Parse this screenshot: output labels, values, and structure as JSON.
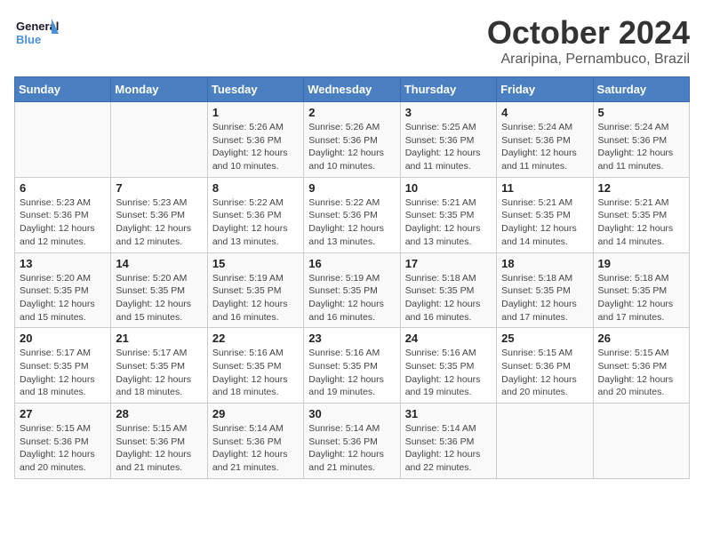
{
  "logo": {
    "line1": "General",
    "line2": "Blue"
  },
  "title": "October 2024",
  "location": "Araripina, Pernambuco, Brazil",
  "days_of_week": [
    "Sunday",
    "Monday",
    "Tuesday",
    "Wednesday",
    "Thursday",
    "Friday",
    "Saturday"
  ],
  "weeks": [
    [
      {
        "day": "",
        "info": ""
      },
      {
        "day": "",
        "info": ""
      },
      {
        "day": "1",
        "info": "Sunrise: 5:26 AM\nSunset: 5:36 PM\nDaylight: 12 hours\nand 10 minutes."
      },
      {
        "day": "2",
        "info": "Sunrise: 5:26 AM\nSunset: 5:36 PM\nDaylight: 12 hours\nand 10 minutes."
      },
      {
        "day": "3",
        "info": "Sunrise: 5:25 AM\nSunset: 5:36 PM\nDaylight: 12 hours\nand 11 minutes."
      },
      {
        "day": "4",
        "info": "Sunrise: 5:24 AM\nSunset: 5:36 PM\nDaylight: 12 hours\nand 11 minutes."
      },
      {
        "day": "5",
        "info": "Sunrise: 5:24 AM\nSunset: 5:36 PM\nDaylight: 12 hours\nand 11 minutes."
      }
    ],
    [
      {
        "day": "6",
        "info": "Sunrise: 5:23 AM\nSunset: 5:36 PM\nDaylight: 12 hours\nand 12 minutes."
      },
      {
        "day": "7",
        "info": "Sunrise: 5:23 AM\nSunset: 5:36 PM\nDaylight: 12 hours\nand 12 minutes."
      },
      {
        "day": "8",
        "info": "Sunrise: 5:22 AM\nSunset: 5:36 PM\nDaylight: 12 hours\nand 13 minutes."
      },
      {
        "day": "9",
        "info": "Sunrise: 5:22 AM\nSunset: 5:36 PM\nDaylight: 12 hours\nand 13 minutes."
      },
      {
        "day": "10",
        "info": "Sunrise: 5:21 AM\nSunset: 5:35 PM\nDaylight: 12 hours\nand 13 minutes."
      },
      {
        "day": "11",
        "info": "Sunrise: 5:21 AM\nSunset: 5:35 PM\nDaylight: 12 hours\nand 14 minutes."
      },
      {
        "day": "12",
        "info": "Sunrise: 5:21 AM\nSunset: 5:35 PM\nDaylight: 12 hours\nand 14 minutes."
      }
    ],
    [
      {
        "day": "13",
        "info": "Sunrise: 5:20 AM\nSunset: 5:35 PM\nDaylight: 12 hours\nand 15 minutes."
      },
      {
        "day": "14",
        "info": "Sunrise: 5:20 AM\nSunset: 5:35 PM\nDaylight: 12 hours\nand 15 minutes."
      },
      {
        "day": "15",
        "info": "Sunrise: 5:19 AM\nSunset: 5:35 PM\nDaylight: 12 hours\nand 16 minutes."
      },
      {
        "day": "16",
        "info": "Sunrise: 5:19 AM\nSunset: 5:35 PM\nDaylight: 12 hours\nand 16 minutes."
      },
      {
        "day": "17",
        "info": "Sunrise: 5:18 AM\nSunset: 5:35 PM\nDaylight: 12 hours\nand 16 minutes."
      },
      {
        "day": "18",
        "info": "Sunrise: 5:18 AM\nSunset: 5:35 PM\nDaylight: 12 hours\nand 17 minutes."
      },
      {
        "day": "19",
        "info": "Sunrise: 5:18 AM\nSunset: 5:35 PM\nDaylight: 12 hours\nand 17 minutes."
      }
    ],
    [
      {
        "day": "20",
        "info": "Sunrise: 5:17 AM\nSunset: 5:35 PM\nDaylight: 12 hours\nand 18 minutes."
      },
      {
        "day": "21",
        "info": "Sunrise: 5:17 AM\nSunset: 5:35 PM\nDaylight: 12 hours\nand 18 minutes."
      },
      {
        "day": "22",
        "info": "Sunrise: 5:16 AM\nSunset: 5:35 PM\nDaylight: 12 hours\nand 18 minutes."
      },
      {
        "day": "23",
        "info": "Sunrise: 5:16 AM\nSunset: 5:35 PM\nDaylight: 12 hours\nand 19 minutes."
      },
      {
        "day": "24",
        "info": "Sunrise: 5:16 AM\nSunset: 5:35 PM\nDaylight: 12 hours\nand 19 minutes."
      },
      {
        "day": "25",
        "info": "Sunrise: 5:15 AM\nSunset: 5:36 PM\nDaylight: 12 hours\nand 20 minutes."
      },
      {
        "day": "26",
        "info": "Sunrise: 5:15 AM\nSunset: 5:36 PM\nDaylight: 12 hours\nand 20 minutes."
      }
    ],
    [
      {
        "day": "27",
        "info": "Sunrise: 5:15 AM\nSunset: 5:36 PM\nDaylight: 12 hours\nand 20 minutes."
      },
      {
        "day": "28",
        "info": "Sunrise: 5:15 AM\nSunset: 5:36 PM\nDaylight: 12 hours\nand 21 minutes."
      },
      {
        "day": "29",
        "info": "Sunrise: 5:14 AM\nSunset: 5:36 PM\nDaylight: 12 hours\nand 21 minutes."
      },
      {
        "day": "30",
        "info": "Sunrise: 5:14 AM\nSunset: 5:36 PM\nDaylight: 12 hours\nand 21 minutes."
      },
      {
        "day": "31",
        "info": "Sunrise: 5:14 AM\nSunset: 5:36 PM\nDaylight: 12 hours\nand 22 minutes."
      },
      {
        "day": "",
        "info": ""
      },
      {
        "day": "",
        "info": ""
      }
    ]
  ]
}
